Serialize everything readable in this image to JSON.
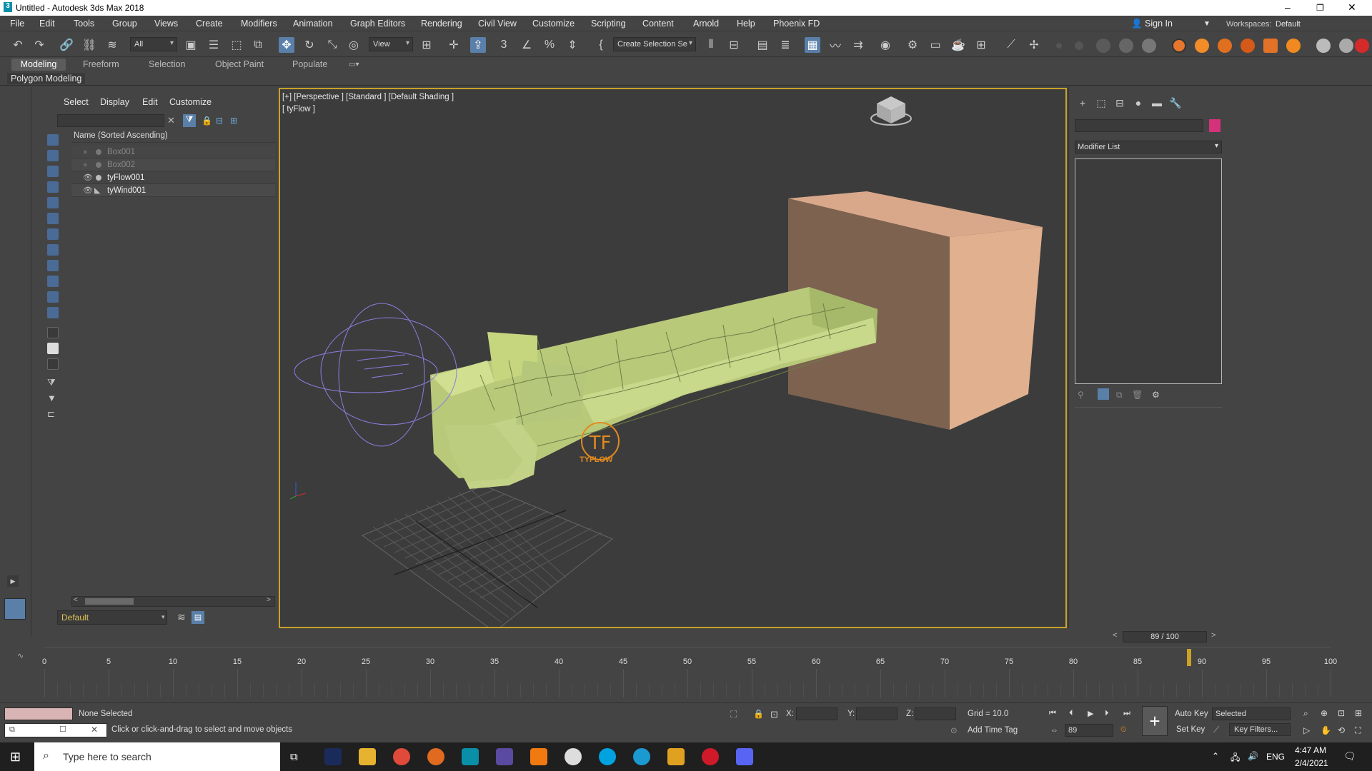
{
  "window": {
    "title": "Untitled - Autodesk 3ds Max 2018",
    "minimize": "–",
    "maximize": "❐",
    "close": "✕"
  },
  "menu": [
    "File",
    "Edit",
    "Tools",
    "Group",
    "Views",
    "Create",
    "Modifiers",
    "Animation",
    "Graph Editors",
    "Rendering",
    "Civil View",
    "Customize",
    "Scripting",
    "Content",
    "Arnold",
    "Help",
    "Phoenix FD"
  ],
  "account": {
    "signin": "Sign In",
    "workspaces_label": "Workspaces:",
    "workspace": "Default"
  },
  "toolbar": {
    "filter": "All",
    "refcoord": "View",
    "selection_set": "Create Selection Se"
  },
  "ribbon": {
    "tabs": [
      "Modeling",
      "Freeform",
      "Selection",
      "Object Paint",
      "Populate"
    ],
    "active": "Modeling",
    "panel": "Polygon Modeling"
  },
  "scene_explorer": {
    "tabs": [
      "Select",
      "Display",
      "Edit",
      "Customize"
    ],
    "column_header": "Name (Sorted Ascending)",
    "items": [
      {
        "name": "Box001",
        "hidden": true
      },
      {
        "name": "Box002",
        "hidden": true
      },
      {
        "name": "tyFlow001",
        "hidden": false
      },
      {
        "name": "tyWind001",
        "hidden": false
      }
    ],
    "layer": "Default"
  },
  "viewport": {
    "label": "[+] [Perspective ] [Standard ] [Default Shading ]",
    "sublabel": "[ tyFlow ]",
    "logo_text": "TYFLOW"
  },
  "command_panel": {
    "modifier_list": "Modifier List",
    "color": "#d4327a"
  },
  "timeline": {
    "frame_display": "89 / 100",
    "current_frame": 89,
    "total_frames": 100,
    "ticks": [
      0,
      5,
      10,
      15,
      20,
      25,
      30,
      35,
      40,
      45,
      50,
      55,
      60,
      65,
      70,
      75,
      80,
      85,
      90,
      95,
      100
    ]
  },
  "status": {
    "selection": "None Selected",
    "prompt": "Click or click-and-drag to select and move objects",
    "x_label": "X:",
    "y_label": "Y:",
    "z_label": "Z:",
    "grid": "Grid = 10.0",
    "add_time_tag": "Add Time Tag",
    "auto_key": "Auto Key",
    "set_key": "Set Key",
    "key_mode": "Selected",
    "key_filters": "Key Filters...",
    "frame_spinner": "89"
  },
  "taskbar": {
    "search_placeholder": "Type here to search",
    "time": "4:47 AM",
    "date": "2/4/2021",
    "lang": "ENG"
  }
}
